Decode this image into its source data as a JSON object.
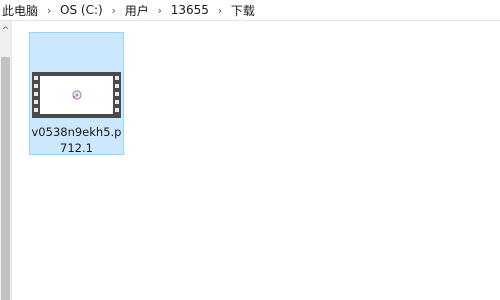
{
  "breadcrumb": {
    "items": [
      "此电脑",
      "OS (C:)",
      "用户",
      "13655",
      "下载"
    ],
    "separator": "›"
  },
  "scrollbar": {
    "up_arrow": "^"
  },
  "files": [
    {
      "name": "v0538n9ekh5.p712.1",
      "icon": "video-file-icon"
    }
  ],
  "colors": {
    "selection_bg": "#cce8ff",
    "selection_border": "#99d1ff",
    "film_strip": "#4a4a4a"
  }
}
